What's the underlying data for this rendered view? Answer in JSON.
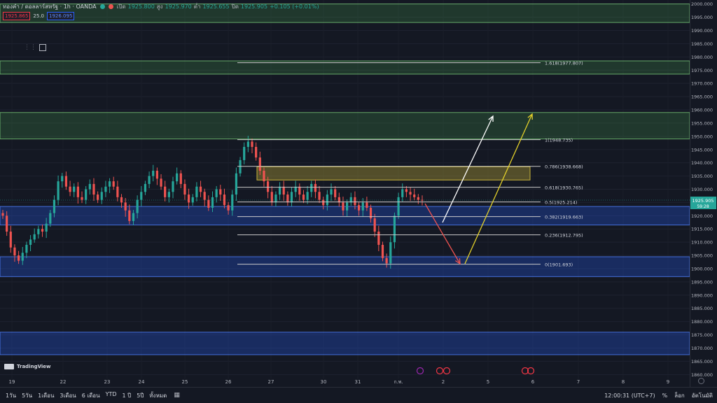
{
  "header": {
    "symbol": "ทองคำ / ดอลลาร์สหรัฐ · 1h · OANDA",
    "open_label": "เปิด",
    "open": "1925.800",
    "high_label": "สูง",
    "high": "1925.970",
    "low_label": "ต่ำ",
    "low": "1925.655",
    "close_label": "ปิด",
    "close": "1925.905",
    "change": "+0.105 (+0.01%)",
    "sell_price": "1925.865",
    "spread": "25.0",
    "buy_price": "1926.095"
  },
  "colors": {
    "background": "#141823",
    "bull": "#26a69a",
    "bear": "#ef5350",
    "green_zone": "#4caf50",
    "blue_zone": "#2962ff",
    "yellow_zone": "#c9b53a"
  },
  "logo_text": "TradingView",
  "bottom_bar": {
    "timeframes": [
      "1วัน",
      "5วัน",
      "1เดือน",
      "3เดือน",
      "6 เดือน",
      "YTD",
      "1 ปี",
      "5ปี",
      "ทั้งหมด"
    ],
    "time": "12:00:31 (UTC+7)",
    "percent": "%",
    "log": "ล็อก",
    "auto": "อัตโนมัติ"
  },
  "chart_data": {
    "type": "candlestick",
    "y_ticks": [
      "2000.000",
      "1995.000",
      "1990.000",
      "1985.000",
      "1980.000",
      "1975.000",
      "1970.000",
      "1965.000",
      "1960.000",
      "1955.000",
      "1950.000",
      "1945.000",
      "1940.000",
      "1935.000",
      "1930.000",
      "1925.000",
      "1920.000",
      "1915.000",
      "1910.000",
      "1905.000",
      "1900.000",
      "1895.000",
      "1890.000",
      "1885.000",
      "1880.000",
      "1875.000",
      "1870.000",
      "1865.000",
      "1860.000"
    ],
    "ylim": [
      1858.5,
      2001.5
    ],
    "x_ticks": [
      "19",
      "22",
      "23",
      "24",
      "25",
      "26",
      "27",
      "30",
      "31",
      "ก.พ.",
      "2",
      "5",
      "6",
      "7",
      "8",
      "9"
    ],
    "last_price": "1925.905",
    "countdown": "59:28",
    "fib_levels": [
      {
        "label": "1.618(1977.807)",
        "value": 1977.807
      },
      {
        "label": "1(1948.735)",
        "value": 1948.735
      },
      {
        "label": "0.786(1938.668)",
        "value": 1938.668
      },
      {
        "label": "0.618(1930.765)",
        "value": 1930.765
      },
      {
        "label": "0.5(1925.214)",
        "value": 1925.214
      },
      {
        "label": "0.382(1919.663)",
        "value": 1919.663
      },
      {
        "label": "0.236(1912.795)",
        "value": 1912.795
      },
      {
        "label": "0(1901.693)",
        "value": 1901.693
      }
    ],
    "zones": [
      {
        "kind": "supply",
        "top": 2000.0,
        "bottom": 1993.0,
        "x_start": "left",
        "x_end": "right"
      },
      {
        "kind": "supply",
        "top": 1978.5,
        "bottom": 1973.5,
        "x_start": "left",
        "x_end": "right"
      },
      {
        "kind": "supply",
        "top": 1959.0,
        "bottom": 1949.0,
        "x_start": "left",
        "x_end": "right"
      },
      {
        "kind": "demand",
        "top": 1923.5,
        "bottom": 1916.5,
        "x_start": "left",
        "x_end": "right"
      },
      {
        "kind": "demand",
        "top": 1904.5,
        "bottom": 1897.0,
        "x_start": "left",
        "x_end": "right"
      },
      {
        "kind": "demand",
        "top": 1876.0,
        "bottom": 1867.5,
        "x_start": "left",
        "x_end": "right"
      },
      {
        "kind": "pending",
        "top": 1938.5,
        "bottom": 1933.5,
        "x_start": "27",
        "x_end": "5"
      }
    ],
    "series": [
      {
        "close": [
          1920,
          1914,
          1908,
          1905,
          1903,
          1906,
          1909,
          1911,
          1913,
          1915,
          1914,
          1917,
          1921,
          1926,
          1933,
          1935,
          1931,
          1929,
          1931,
          1927,
          1926,
          1930,
          1932,
          1928,
          1926,
          1929,
          1931,
          1933,
          1931,
          1927,
          1925,
          1922,
          1918,
          1921,
          1926,
          1929,
          1932,
          1935,
          1937,
          1934,
          1931,
          1927,
          1929,
          1933,
          1936,
          1932,
          1928,
          1925,
          1927,
          1931,
          1929,
          1926,
          1923,
          1927,
          1930,
          1928,
          1924,
          1922,
          1928,
          1936,
          1941,
          1946,
          1948,
          1946,
          1942,
          1937,
          1933,
          1929,
          1925,
          1928,
          1931,
          1928,
          1925,
          1929,
          1931,
          1928,
          1926,
          1929,
          1932,
          1929,
          1926,
          1924,
          1928,
          1930,
          1927,
          1925,
          1922,
          1925,
          1927,
          1924,
          1922,
          1925,
          1923,
          1919,
          1914,
          1909,
          1904,
          1902,
          1910,
          1920,
          1927,
          1930,
          1929,
          1928,
          1927,
          1926,
          1925.9
        ]
      }
    ]
  }
}
